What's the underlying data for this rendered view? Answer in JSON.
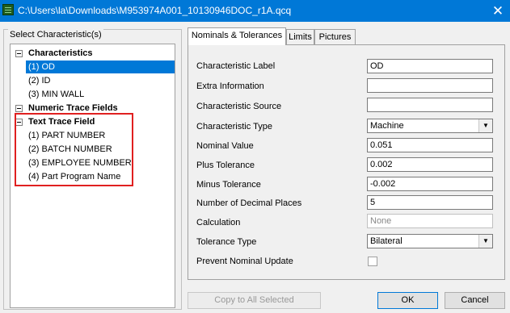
{
  "window": {
    "title": "C:\\Users\\la\\Downloads\\M953974A001_10130946DOC_r1A.qcq",
    "close_glyph": "✕"
  },
  "group_label": "Select Characteristic(s)",
  "tree": {
    "characteristics": {
      "label": "Characteristics",
      "items": [
        "(1) OD",
        "(2) ID",
        "(3) MIN WALL"
      ],
      "selected_index": 0
    },
    "numeric_trace_fields": {
      "label": "Numeric Trace Fields"
    },
    "text_trace_field": {
      "label": "Text Trace Field",
      "items": [
        "(1) PART NUMBER",
        "(2) BATCH NUMBER",
        "(3) EMPLOYEE NUMBER",
        "(4) Part Program Name"
      ]
    }
  },
  "tabs": [
    "Nominals & Tolerances",
    "Limits",
    "Pictures"
  ],
  "form": {
    "characteristic_label": {
      "label": "Characteristic Label",
      "value": "OD"
    },
    "extra_information": {
      "label": "Extra Information",
      "value": ""
    },
    "characteristic_source": {
      "label": "Characteristic Source",
      "value": ""
    },
    "characteristic_type": {
      "label": "Characteristic Type",
      "value": "Machine"
    },
    "nominal_value": {
      "label": "Nominal Value",
      "value": "0.051"
    },
    "plus_tolerance": {
      "label": "Plus Tolerance",
      "value": "0.002"
    },
    "minus_tolerance": {
      "label": "Minus Tolerance",
      "value": "-0.002"
    },
    "decimal_places": {
      "label": "Number of Decimal Places",
      "value": "5"
    },
    "calculation": {
      "label": "Calculation",
      "value": "None"
    },
    "tolerance_type": {
      "label": "Tolerance Type",
      "value": "Bilateral"
    },
    "prevent_nominal_update": {
      "label": "Prevent Nominal Update",
      "checked": false
    }
  },
  "buttons": {
    "copy_all": "Copy to All Selected",
    "ok": "OK",
    "cancel": "Cancel"
  },
  "colors": {
    "titlebar": "#0078d7",
    "selection": "#0078d7",
    "highlight_border": "#e02020"
  }
}
